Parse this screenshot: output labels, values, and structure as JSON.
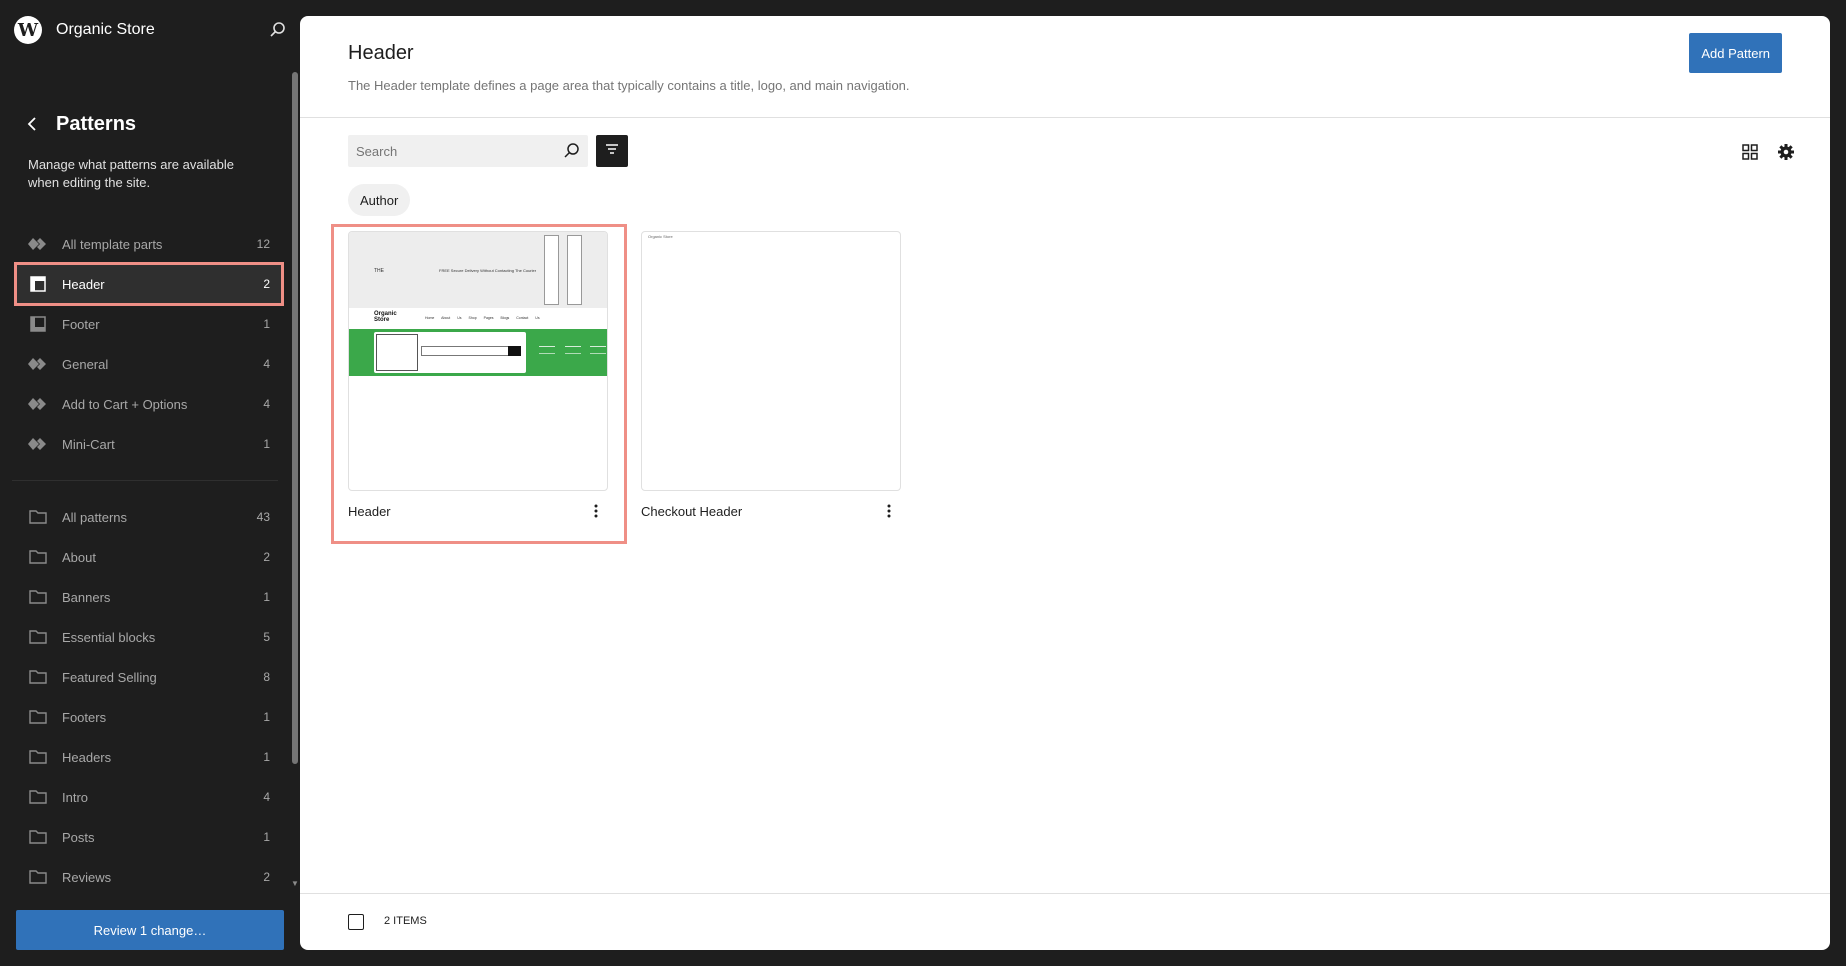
{
  "site": {
    "title": "Organic Store"
  },
  "sidebar": {
    "title": "Patterns",
    "description": "Manage what patterns are available when editing the site.",
    "template_parts": [
      {
        "label": "All template parts",
        "count": "12",
        "icon": "symbol-icon"
      },
      {
        "label": "Header",
        "count": "2",
        "icon": "header-icon",
        "active": true
      },
      {
        "label": "Footer",
        "count": "1",
        "icon": "footer-icon"
      },
      {
        "label": "General",
        "count": "4",
        "icon": "symbol-icon"
      },
      {
        "label": "Add to Cart + Options",
        "count": "4",
        "icon": "symbol-icon"
      },
      {
        "label": "Mini-Cart",
        "count": "1",
        "icon": "symbol-icon"
      }
    ],
    "categories": [
      {
        "label": "All patterns",
        "count": "43"
      },
      {
        "label": "About",
        "count": "2"
      },
      {
        "label": "Banners",
        "count": "1"
      },
      {
        "label": "Essential blocks",
        "count": "5"
      },
      {
        "label": "Featured Selling",
        "count": "8"
      },
      {
        "label": "Footers",
        "count": "1"
      },
      {
        "label": "Headers",
        "count": "1"
      },
      {
        "label": "Intro",
        "count": "4"
      },
      {
        "label": "Posts",
        "count": "1"
      },
      {
        "label": "Reviews",
        "count": "2"
      }
    ],
    "review_label": "Review 1 change…"
  },
  "main": {
    "title": "Header",
    "description": "The Header template defines a page area that typically contains a title, logo, and main navigation.",
    "add_pattern_label": "Add Pattern",
    "search_placeholder": "Search",
    "filter_chip": "Author",
    "cards": [
      {
        "title": "Header"
      },
      {
        "title": "Checkout Header"
      }
    ],
    "preview": {
      "logo": "THE",
      "tagline": "FREE Secure Delivery Without Contacting The Courier",
      "brand": "Organic Store",
      "links": "Home About Us Shop Pages Blogs Contact Us",
      "checkout_brand": "Organic Store"
    },
    "items_count": "2 ITEMS"
  },
  "colors": {
    "accent": "#3072b9",
    "highlight": "#ef8f86",
    "sidebar_bg": "#1e1e1e",
    "preview_green": "#3ba84a"
  }
}
